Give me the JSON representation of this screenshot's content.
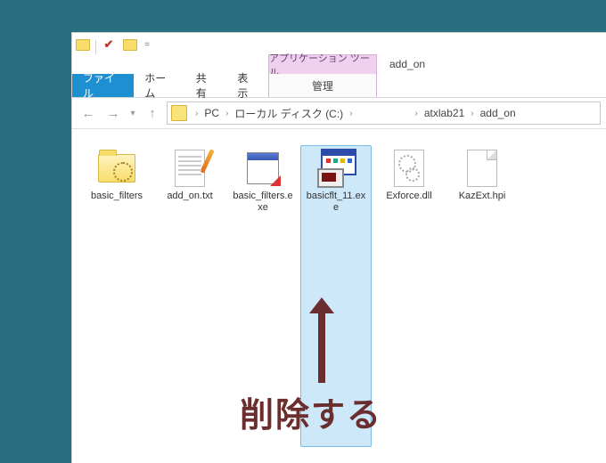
{
  "qa": {
    "folder_icon": "folder-icon",
    "check_glyph": "✔",
    "drop_glyph": "▾",
    "eq_glyph": "="
  },
  "context_tab": {
    "header": "アプリケーション ツール",
    "tab_label": "管理"
  },
  "app_title": "add_on",
  "ribbon": {
    "file": "ファイル",
    "home": "ホーム",
    "share": "共有",
    "view": "表示"
  },
  "nav": {
    "back_glyph": "←",
    "fwd_glyph": "→",
    "recent_glyph": "▾",
    "up_glyph": "↑"
  },
  "breadcrumb": {
    "pc": "PC",
    "drive": "ローカル ディスク (C:)",
    "atxlab": "atxlab21",
    "addon": "add_on",
    "sep": "›"
  },
  "files": [
    {
      "name": "basic_filters",
      "kind": "folder",
      "selected": false
    },
    {
      "name": "add_on.txt",
      "kind": "txt",
      "selected": false
    },
    {
      "name": "basic_filters.exe",
      "kind": "exe-small",
      "selected": false
    },
    {
      "name": "basicflt_11.exe",
      "kind": "basicflt",
      "selected": true
    },
    {
      "name": "Exforce.dll",
      "kind": "dll",
      "selected": false
    },
    {
      "name": "KazExt.hpi",
      "kind": "hpi",
      "selected": false
    }
  ],
  "annotation": {
    "text": "削除する",
    "color": "#6b2e2e"
  }
}
